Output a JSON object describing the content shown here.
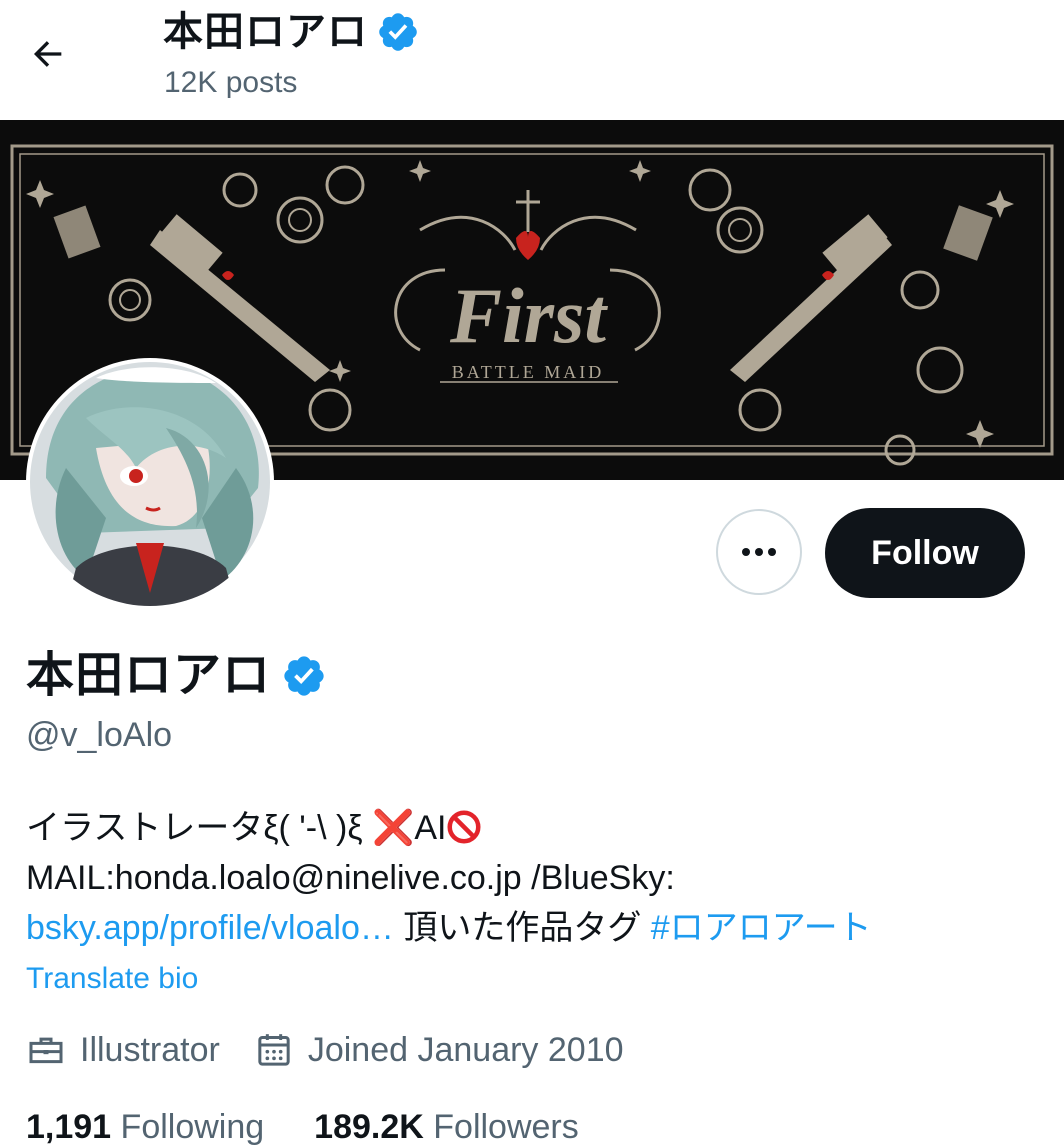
{
  "header": {
    "name": "本田ロアロ",
    "posts": "12K posts"
  },
  "banner": {
    "title": "First",
    "subtitle": "BATTLE MAID"
  },
  "actions": {
    "follow_label": "Follow"
  },
  "profile": {
    "display_name": "本田ロアロ",
    "handle": "@v_loAlo",
    "bio": {
      "line1_text": "イラストレータξ( '-\\ )ξ ",
      "line1_x": "❌",
      "line1_ai": "AI",
      "line2": "MAIL:honda.loalo@ninelive.co.jp /BlueSky:",
      "line3_link": "bsky.app/profile/vloalo…",
      "line3_text": " 頂いた作品タグ ",
      "line3_hashtag": "#ロアロアート"
    },
    "translate_label": "Translate bio",
    "profession": "Illustrator",
    "joined": "Joined January 2010",
    "following_count": "1,191",
    "following_label": "Following",
    "followers_count": "189.2K",
    "followers_label": "Followers"
  },
  "colors": {
    "accent": "#1d9bf0",
    "text_primary": "#0f1419",
    "text_secondary": "#536471",
    "verified": "#1d9bf0"
  },
  "icons": [
    "back-arrow-icon",
    "verified-badge-icon",
    "more-icon",
    "briefcase-icon",
    "calendar-icon",
    "prohibited-icon"
  ]
}
